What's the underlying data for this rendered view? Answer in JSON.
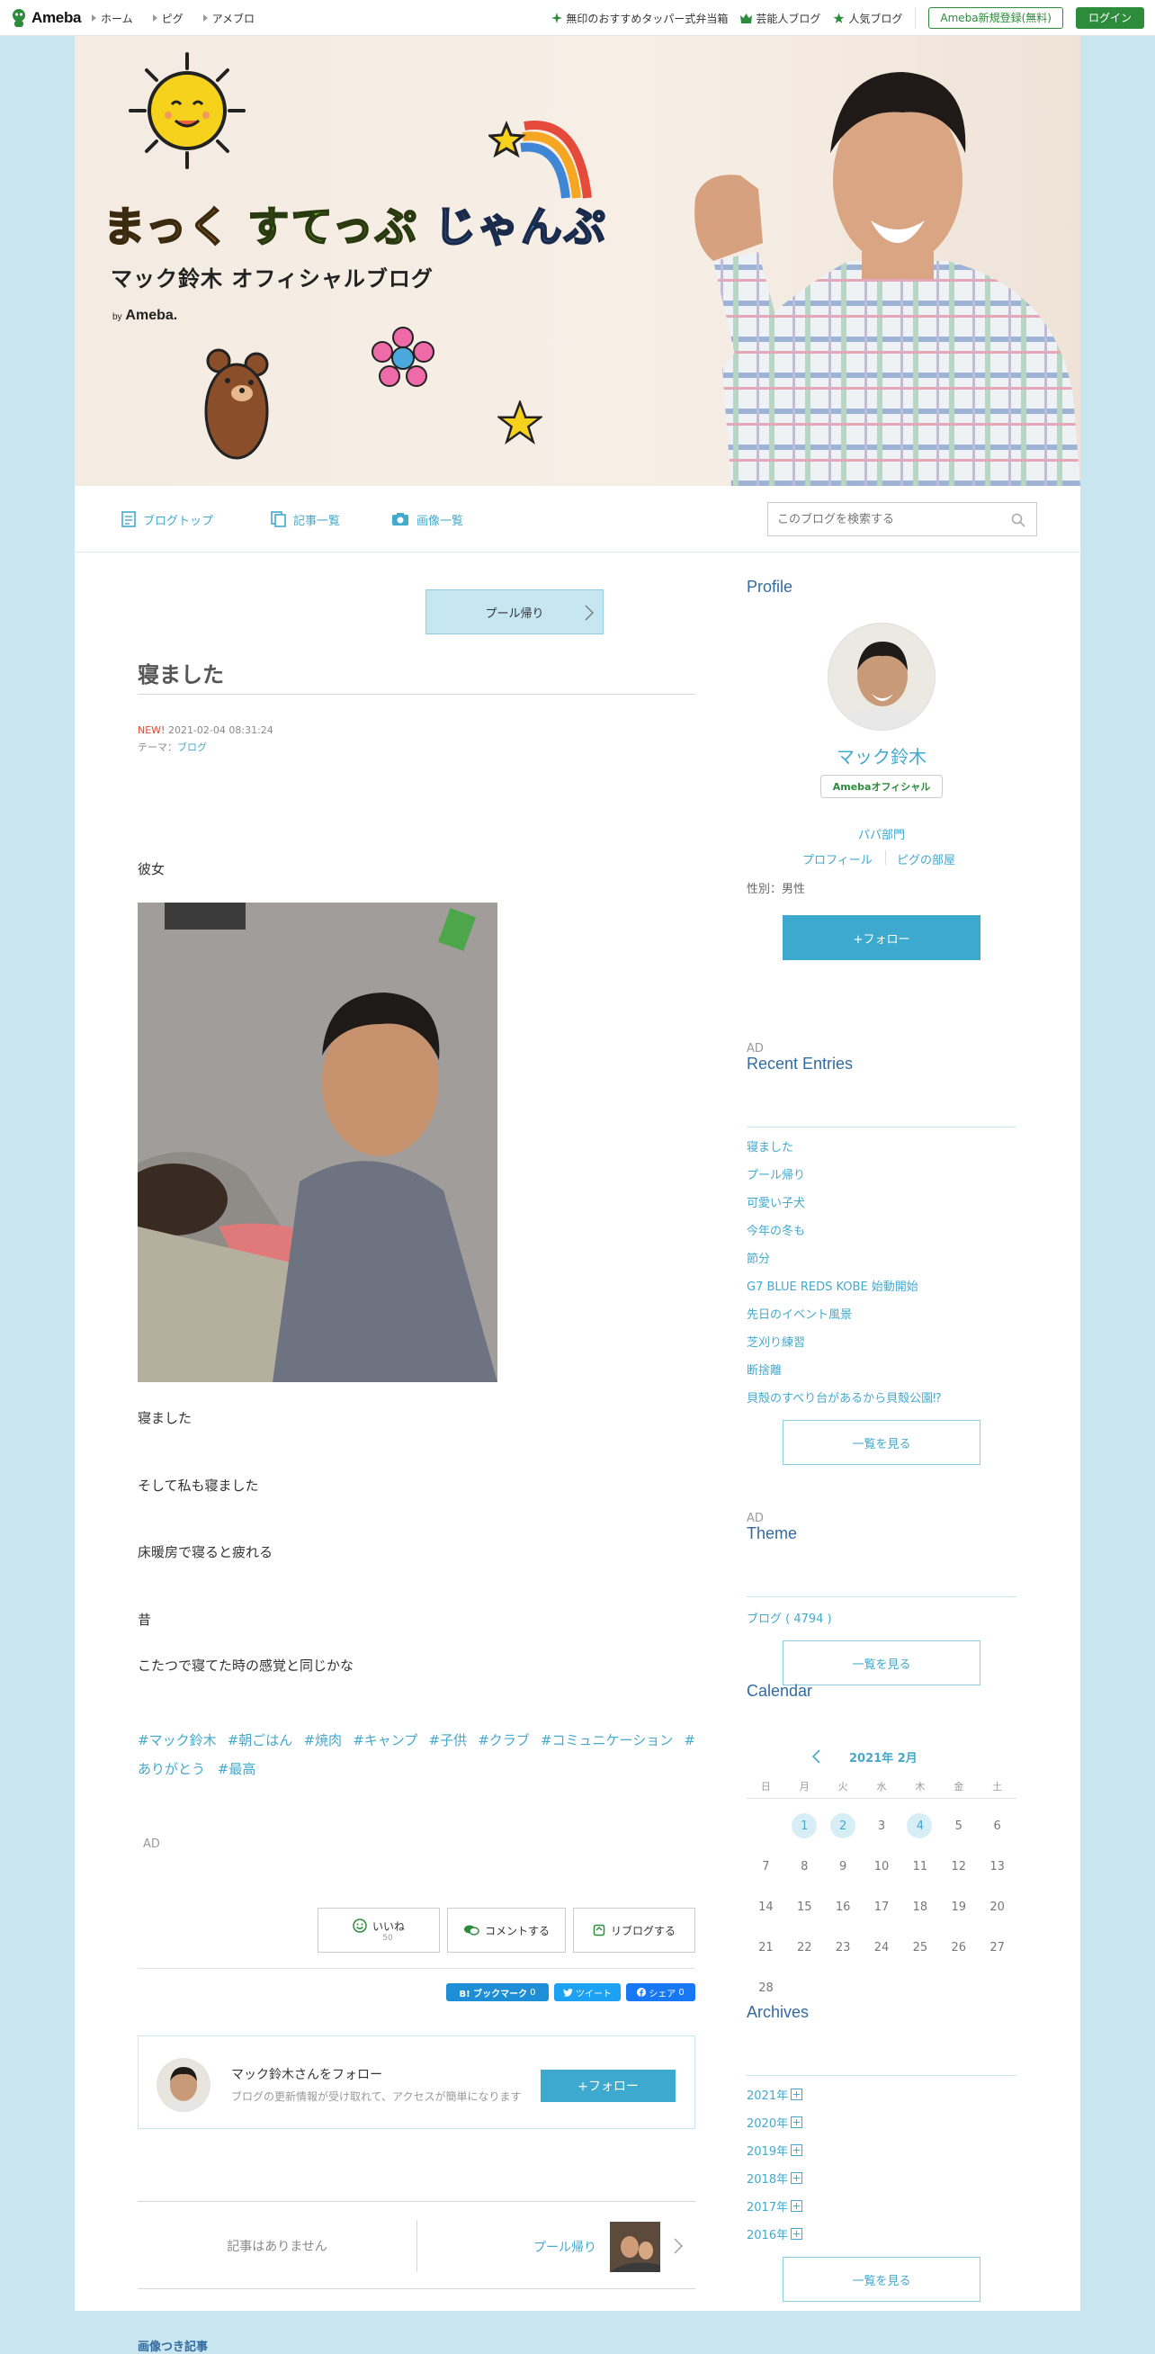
{
  "topbar": {
    "logo": "Ameba",
    "nav": [
      "ホーム",
      "ピグ",
      "アメブロ"
    ],
    "links": [
      "無印のおすすめタッパー式弁当箱",
      "芸能人ブログ",
      "人気ブログ"
    ],
    "register_label": "Ameba新規登録(無料)",
    "login_label": "ログイン"
  },
  "hero": {
    "title_1": "まっく",
    "title_2": "すてっぷ",
    "title_3": "じゃんぷ",
    "subtitle": "マック鈴木 オフィシャルブログ",
    "by": "by",
    "brand": "Ameba."
  },
  "blognav": {
    "items": [
      "ブログトップ",
      "記事一覧",
      "画像一覧"
    ],
    "search_placeholder": "このブログを検索する"
  },
  "article": {
    "next_title": "プール帰り",
    "title": "寝ました",
    "new_label": "NEW!",
    "date": "2021-02-04 08:31:24",
    "theme_label": "テーマ：",
    "theme": "ブログ",
    "paragraphs": [
      "彼女",
      "寝ました",
      "そして私も寝ました",
      "床暖房で寝ると疲れる",
      "昔",
      "こたつで寝てた時の感覚と同じかな"
    ],
    "tags_line1": [
      "#マック鈴木",
      "#朝ごはん",
      "#焼肉",
      "#キャンプ",
      "#子供",
      "#クラブ",
      "#コミュニケーション",
      "#"
    ],
    "tags_line2": [
      "ありがとう",
      "#最高"
    ],
    "ad_label": "AD",
    "like_label": "いいね",
    "like_count": "50",
    "comment_label": "コメントする",
    "reblog_label": "リブログする",
    "share": {
      "hatena_label": "B! ブックマーク",
      "hatena_count": "0",
      "tweet_label": "ツイート",
      "fb_label": "シェア",
      "fb_count": "0"
    },
    "follow_name": "マック鈴木さんをフォロー",
    "follow_desc": "ブログの更新情報が受け取れて、アクセスが簡単になります",
    "follow_btn": "+フォロー",
    "prev_none": "記事はありません",
    "next_link": "プール帰り",
    "image_posts": "画像つき記事"
  },
  "sidebar": {
    "profile_heading": "Profile",
    "name": "マック鈴木",
    "badge": "Amebaオフィシャル",
    "category": "パパ部門",
    "link_profile": "プロフィール",
    "link_pig": "ピグの部屋",
    "gender": "性別：男性",
    "follow_btn": "+フォロー",
    "ad1": "AD",
    "recent_heading": "Recent Entries",
    "recent": [
      "寝ました",
      "プール帰り",
      "可愛い子犬",
      "今年の冬も",
      "節分",
      "G7 BLUE REDS KOBE 始動開始",
      "先日のイベント風景",
      "芝刈り練習",
      "断捨離",
      "貝殻のすべり台があるから貝殻公園⁉"
    ],
    "see_all": "一覧を見る",
    "ad2": "AD",
    "theme_heading": "Theme",
    "theme_item": "ブログ ( 4794 )",
    "calendar_heading": "Calendar",
    "calendar_month": "2021年 2月",
    "weekdays": [
      "日",
      "月",
      "火",
      "水",
      "木",
      "金",
      "土"
    ],
    "archives_heading": "Archives",
    "archives": [
      "2021年",
      "2020年",
      "2019年",
      "2018年",
      "2017年",
      "2016年"
    ]
  }
}
